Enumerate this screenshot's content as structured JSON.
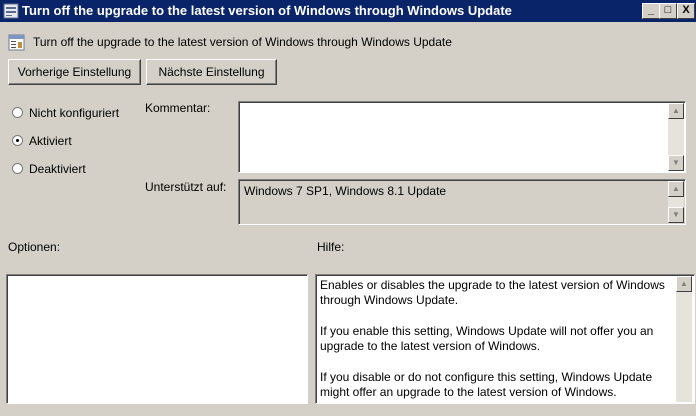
{
  "window": {
    "title": "Turn off the upgrade to the latest version of Windows through Windows Update",
    "controls": {
      "minimize": "_",
      "maximize": "□",
      "close": "X"
    }
  },
  "header": {
    "policy_title": "Turn off the upgrade to the latest version of Windows through Windows Update",
    "policy_icon": "policy-setting-icon"
  },
  "nav": {
    "previous_label": "Vorherige Einstellung",
    "next_label": "Nächste Einstellung"
  },
  "state": {
    "options": [
      {
        "label": "Nicht konfiguriert",
        "selected": false
      },
      {
        "label": "Aktiviert",
        "selected": true
      },
      {
        "label": "Deaktiviert",
        "selected": false
      }
    ]
  },
  "comment": {
    "label": "Kommentar:",
    "value": ""
  },
  "supported": {
    "label": "Unterstützt auf:",
    "value": "Windows 7 SP1, Windows 8.1 Update"
  },
  "options_panel": {
    "label": "Optionen:"
  },
  "help_panel": {
    "label": "Hilfe:",
    "paragraphs": [
      "Enables or disables the upgrade to the latest version of Windows through Windows Update.",
      "If you enable this setting, Windows Update will not offer you an upgrade to the latest version of Windows.",
      "If you disable or do not configure this setting, Windows Update might offer an upgrade to the latest version of Windows."
    ]
  },
  "colors": {
    "titlebar": "#0a246a",
    "dialog_bg": "#d4d0c8",
    "field_bg": "#ffffff"
  }
}
